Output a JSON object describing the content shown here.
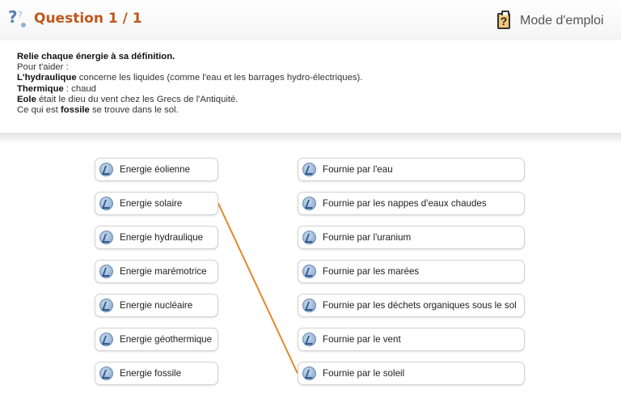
{
  "header": {
    "question_label": "Question 1 / 1",
    "help_label": "Mode d'emploi",
    "help_icon_text": "?"
  },
  "instructions": {
    "title": "Relie chaque énergie à sa définition.",
    "intro": "Pour t'aider :",
    "line1_bold": "L'hydraulique",
    "line1_rest": " concerne les liquides (comme l'eau et les barrages hydro-électriques).",
    "line2_bold": "Thermique",
    "line2_rest": " : chaud",
    "line3_bold": "Eole",
    "line3_rest": " était le dieu du vent chez les Grecs de l'Antiquité.",
    "line4_pre": "Ce qui est ",
    "line4_bold": "fossile",
    "line4_rest": " se trouve dans le sol."
  },
  "left_items": [
    {
      "label": "Energie éolienne"
    },
    {
      "label": "Energie solaire"
    },
    {
      "label": "Energie hydraulique"
    },
    {
      "label": "Energie marémotrice"
    },
    {
      "label": "Energie nucléaire"
    },
    {
      "label": "Energie géothermique"
    },
    {
      "label": "Energie fossile"
    }
  ],
  "right_items": [
    {
      "label": "Fournie par l'eau"
    },
    {
      "label": "Fournie par les nappes d'eaux chaudes"
    },
    {
      "label": "Fournie par l'uranium"
    },
    {
      "label": "Fournie par les marées"
    },
    {
      "label": "Fournie par les déchets organiques sous le sol"
    },
    {
      "label": "Fournie par le vent"
    },
    {
      "label": "Fournie par le soleil"
    }
  ],
  "connections": [
    {
      "from_left": 1,
      "to_right": 6,
      "color": "#e08a2c"
    }
  ],
  "colors": {
    "title": "#c0571a",
    "connector": "#e08a2c"
  },
  "icons": {
    "question": "question-mark-icon",
    "help": "clipboard-help-icon",
    "item": "energy-bolt-icon"
  }
}
